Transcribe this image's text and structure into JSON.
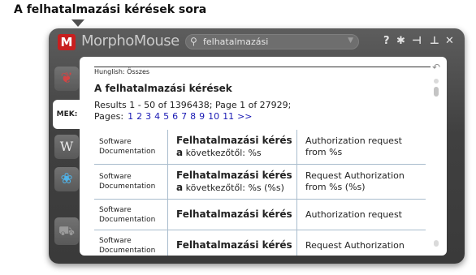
{
  "caption": "A felhatalmazási kérések sora",
  "app": {
    "title": "MorphoMouse",
    "logo_letter": "M",
    "search": {
      "value": "felhatalmazási"
    }
  },
  "toolbar": {
    "help": "?",
    "settings": "✱",
    "pin": "⊣",
    "minimize": "⊥",
    "close": "✕"
  },
  "sidebar": {
    "items": [
      {
        "name": "morphologic-item",
        "glyph": "❦"
      },
      {
        "name": "mek-item",
        "glyph": "MEK:"
      },
      {
        "name": "wikipedia-item",
        "glyph": "W"
      },
      {
        "name": "butterfly-item",
        "glyph": "❀"
      },
      {
        "name": "cart-item",
        "glyph": "⛟"
      }
    ]
  },
  "content": {
    "source_label": "Hunglish: Összes",
    "heading": "A felhatalmazási kérések",
    "results_text": "Results 1 - 50 of 1396438; Page 1 of 27929; Pages:",
    "pages": [
      "1",
      "2",
      "3",
      "4",
      "5",
      "6",
      "7",
      "8",
      "9",
      "10",
      "11",
      ">>"
    ],
    "rows": [
      {
        "source": "Software Documentation",
        "hu_bold": "Felhatalmazási kérés a",
        "hu_rest": "következőtől: %s",
        "en": "Authorization request from %s"
      },
      {
        "source": "Software Documentation",
        "hu_bold": "Felhatalmazási kérés a",
        "hu_rest": "következőtől: %s (%s)",
        "en": "Request Authorization from %s (%s)"
      },
      {
        "source": "Software Documentation",
        "hu_bold": "Felhatalmazási kérés",
        "hu_rest": "",
        "en": "Authorization request"
      },
      {
        "source": "Software Documentation",
        "hu_bold": "Felhatalmazási kérés",
        "hu_rest": "",
        "en": "Request Authorization"
      }
    ]
  },
  "colors": {
    "frame": "#454545",
    "link": "#1a1ab4",
    "grid": "#a9bccd",
    "logo": "#c81f1f"
  }
}
